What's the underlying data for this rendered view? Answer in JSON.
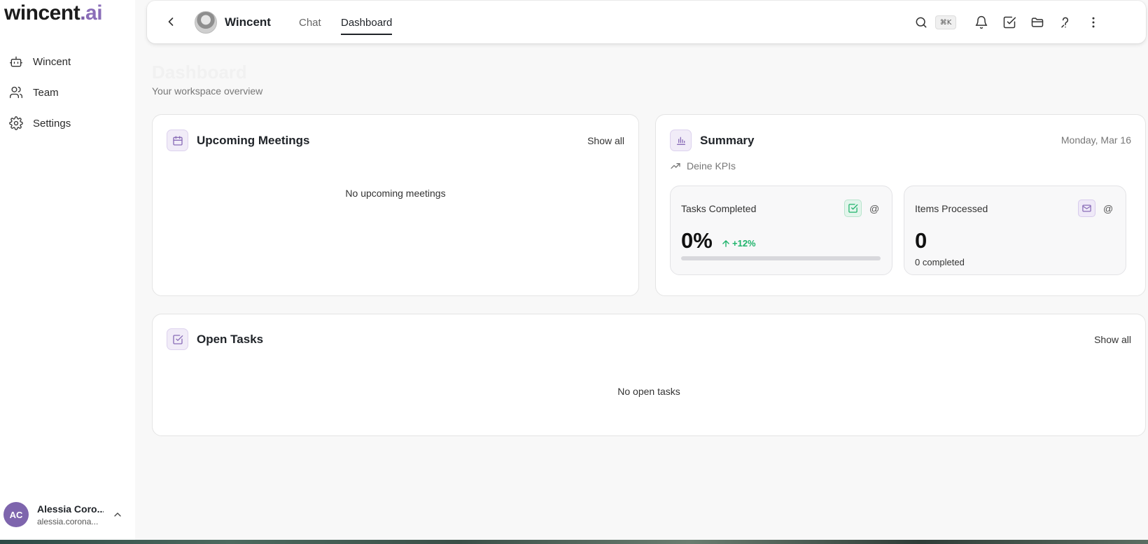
{
  "brand": {
    "name_main": "wincent",
    "name_dot": ".",
    "name_ai": "ai"
  },
  "sidebar": {
    "items": [
      {
        "label": "Wincent",
        "icon": "bot-icon"
      },
      {
        "label": "Team",
        "icon": "users-icon"
      },
      {
        "label": "Settings",
        "icon": "gear-icon"
      }
    ],
    "user": {
      "initials": "AC",
      "name": "Alessia Coro...",
      "email": "alessia.corona..."
    }
  },
  "topbar": {
    "agent_name": "Wincent",
    "tabs": [
      {
        "label": "Chat"
      },
      {
        "label": "Dashboard"
      }
    ],
    "active_tab": "Dashboard",
    "shortcut": "⌘K"
  },
  "page": {
    "title": "Dashboard",
    "subtitle": "Your workspace overview"
  },
  "meetings": {
    "title": "Upcoming Meetings",
    "show_all": "Show all",
    "empty": "No upcoming meetings"
  },
  "summary": {
    "title": "Summary",
    "date": "Monday, Mar 16",
    "kpi_label": "Deine KPIs",
    "tasks_completed": {
      "label": "Tasks Completed",
      "at": "@",
      "value": "0%",
      "delta": "+12%",
      "progress_percent": 0
    },
    "items_processed": {
      "label": "Items Processed",
      "at": "@",
      "value": "0",
      "sub": "0 completed"
    }
  },
  "open_tasks": {
    "title": "Open Tasks",
    "show_all": "Show all",
    "empty": "No open tasks"
  },
  "colors": {
    "accent": "#7e65ad",
    "positive": "#1fb36b",
    "background": "#f8f8f8"
  }
}
